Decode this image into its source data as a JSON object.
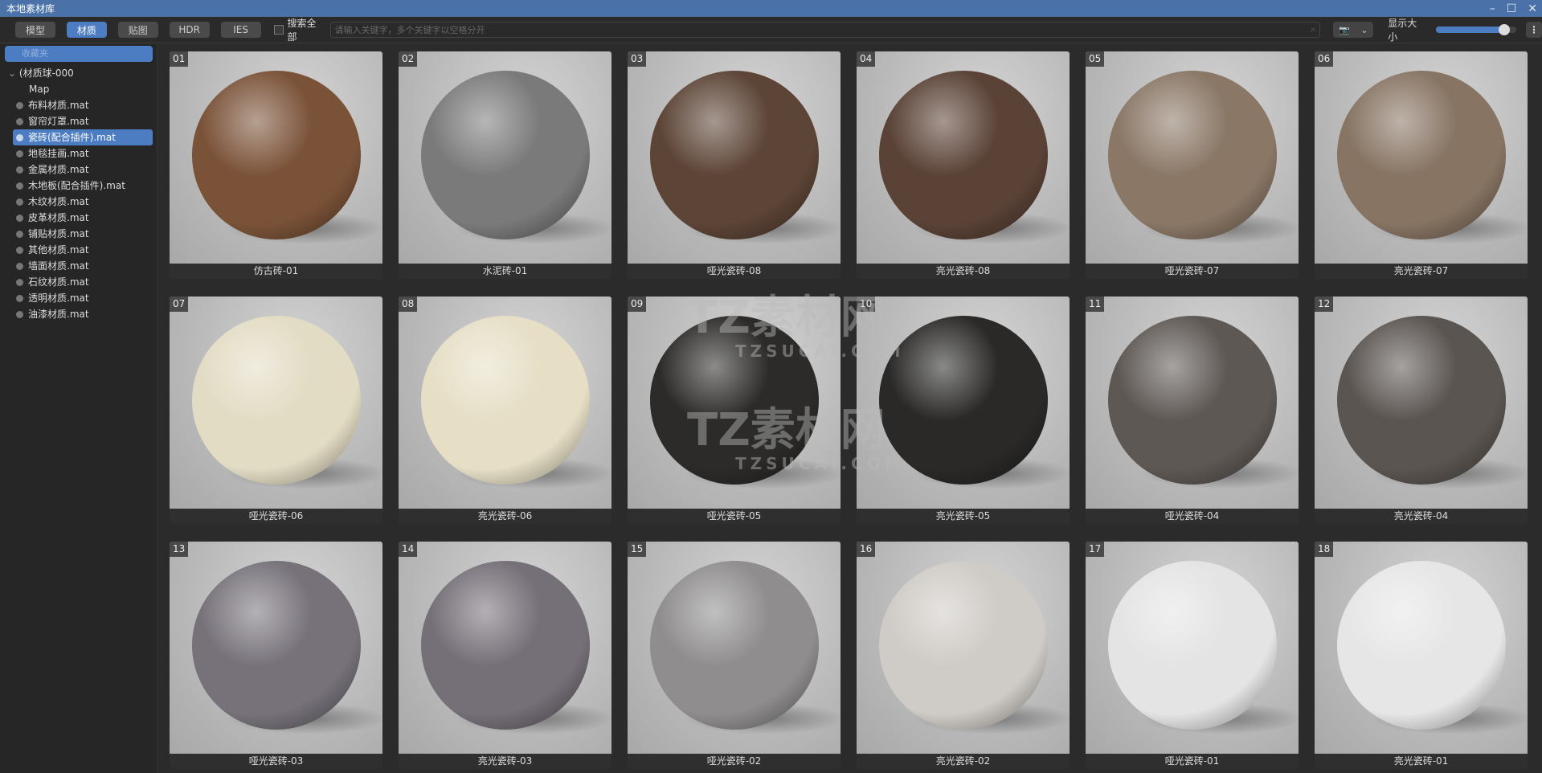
{
  "window": {
    "title": "本地素材库"
  },
  "toolbar": {
    "tabs": [
      {
        "label": "模型",
        "active": false
      },
      {
        "label": "材质",
        "active": true
      },
      {
        "label": "贴图",
        "active": false
      },
      {
        "label": "HDR",
        "active": false
      },
      {
        "label": "IES",
        "active": false
      }
    ],
    "search_all_label": "搜索全部",
    "search_all_checked": false,
    "search_placeholder": "请输入关键字，多个关键字以空格分开",
    "display_size_label": "显示大小",
    "display_size_value": 0.85
  },
  "sidebar": {
    "favorites_label": "收藏夹",
    "root_label": "(材质球-000",
    "map_label": "Map",
    "items": [
      "布料材质.mat",
      "窗帘灯罩.mat",
      "瓷砖(配合插件).mat",
      "地毯挂画.mat",
      "金属材质.mat",
      "木地板(配合插件).mat",
      "木纹材质.mat",
      "皮革材质.mat",
      "铺贴材质.mat",
      "其他材质.mat",
      "墙面材质.mat",
      "石纹材质.mat",
      "透明材质.mat",
      "油漆材质.mat"
    ],
    "selected_index": 2
  },
  "materials": [
    {
      "num": "01",
      "name": "仿古砖-01",
      "color": "#7a5238"
    },
    {
      "num": "02",
      "name": "水泥砖-01",
      "color": "#7a7a7a"
    },
    {
      "num": "03",
      "name": "哑光瓷砖-08",
      "color": "#5c4436"
    },
    {
      "num": "04",
      "name": "亮光瓷砖-08",
      "color": "#5a4236"
    },
    {
      "num": "05",
      "name": "哑光瓷砖-07",
      "color": "#8a7766"
    },
    {
      "num": "06",
      "name": "亮光瓷砖-07",
      "color": "#877463"
    },
    {
      "num": "07",
      "name": "哑光瓷砖-06",
      "color": "#e3dcc4"
    },
    {
      "num": "08",
      "name": "亮光瓷砖-06",
      "color": "#e6dfc6"
    },
    {
      "num": "09",
      "name": "哑光瓷砖-05",
      "color": "#2c2b29"
    },
    {
      "num": "10",
      "name": "亮光瓷砖-05",
      "color": "#2a2928"
    },
    {
      "num": "11",
      "name": "哑光瓷砖-04",
      "color": "#5e5854"
    },
    {
      "num": "12",
      "name": "亮光瓷砖-04",
      "color": "#5b5551"
    },
    {
      "num": "13",
      "name": "哑光瓷砖-03",
      "color": "#77727a"
    },
    {
      "num": "14",
      "name": "亮光瓷砖-03",
      "color": "#756f77"
    },
    {
      "num": "15",
      "name": "哑光瓷砖-02",
      "color": "#8f8d8e"
    },
    {
      "num": "16",
      "name": "亮光瓷砖-02",
      "color": "#cfcbc6"
    },
    {
      "num": "17",
      "name": "哑光瓷砖-01",
      "color": "#e4e4e4"
    },
    {
      "num": "18",
      "name": "亮光瓷砖-01",
      "color": "#e6e6e6"
    }
  ],
  "watermark": {
    "text": "TZ素材网",
    "url": "TZSUCAI.COM"
  }
}
